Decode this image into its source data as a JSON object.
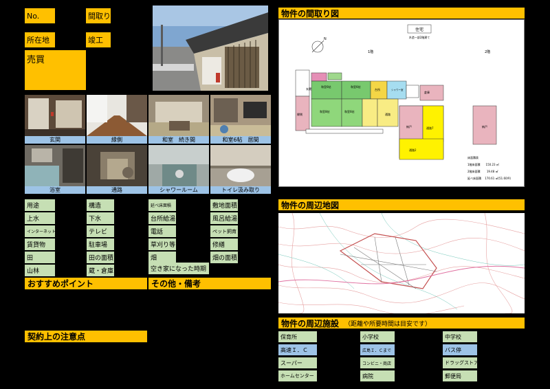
{
  "header": {
    "no_label": "No.",
    "layout_label": "間取り",
    "location_label": "所在地",
    "built_label": "竣工",
    "sale_label": "売買"
  },
  "photos": [
    {
      "caption": "玄関"
    },
    {
      "caption": "縁側"
    },
    {
      "caption": "和室　続き間"
    },
    {
      "caption": "和室6帖　居間"
    },
    {
      "caption": "浴室"
    },
    {
      "caption": "通路"
    },
    {
      "caption": "シャワールーム"
    },
    {
      "caption": "トイレ汲み取り"
    }
  ],
  "specs": {
    "col1": [
      "用途",
      "上水",
      "インターネット",
      "賃貸物",
      "田",
      "山林"
    ],
    "col2": [
      "構造",
      "下水",
      "テレビ",
      "駐車場",
      "田の面積",
      "蔵・倉庫"
    ],
    "col3": [
      "延べ床面積",
      "台所給湯",
      "電話",
      "草刈り等",
      "畑"
    ],
    "col4": [
      "敷地面積",
      "風呂給湯",
      "ペット飼育",
      "修繕",
      "畑の面積"
    ],
    "vacancy": "空き家になった時期"
  },
  "sections": {
    "recommend": "おすすめポイント",
    "remarks": "その他・備考",
    "contract": "契約上の注意点",
    "floorplan": "物件の間取り図",
    "map": "物件の周辺地図",
    "facilities": "物件の周辺施設",
    "facilities_note": "（距離や所要時間は目安です）"
  },
  "floorplan": {
    "title": "住宅",
    "subtitle": "木造一部2階建て",
    "floor1": "1階",
    "floor2": "2階",
    "rooms": {
      "genkan": "玄関",
      "washitsu1": "和室6帖",
      "washitsu2": "和室6帖",
      "washitsu3": "和室8帖",
      "washitsu4": "和室6帖",
      "daidokoro": "台所",
      "shower": "シャワー室",
      "tsuro": "通路",
      "nando": "納戸",
      "tsuro_b": "通路7",
      "tsuro_c": "通路2",
      "soko": "倉庫",
      "engawa": "縁側",
      "nando2": "納戸"
    },
    "area_title": "床面積表",
    "area1": "1階床面積　　150.23 ㎡",
    "area2": "2階床面積　　 19.48 ㎡",
    "area_total": "延べ床面積　 170.61 ㎡(51.60坪)"
  },
  "facilities": [
    {
      "name": "保育所",
      "color": "#C6DFB4"
    },
    {
      "name": "小学校",
      "color": "#C6DFB4"
    },
    {
      "name": "中学校",
      "color": "#C6DFB4"
    },
    {
      "name": "高速Ｉ．Ｃ",
      "color": "#9DC3E6"
    },
    {
      "name": "広島Ｉ．Ｃまで",
      "color": "#9DC3E6"
    },
    {
      "name": "バス停",
      "color": "#9DC3E6"
    },
    {
      "name": "スーパー",
      "color": "#C6DFB4"
    },
    {
      "name": "コンビニ・商店",
      "color": "#C6DFB4"
    },
    {
      "name": "ドラッグストア",
      "color": "#C6DFB4"
    },
    {
      "name": "ホームセンター",
      "color": "#C6DFB4"
    },
    {
      "name": "病院",
      "color": "#C6DFB4"
    },
    {
      "name": "郵便局",
      "color": "#C6DFB4"
    }
  ]
}
